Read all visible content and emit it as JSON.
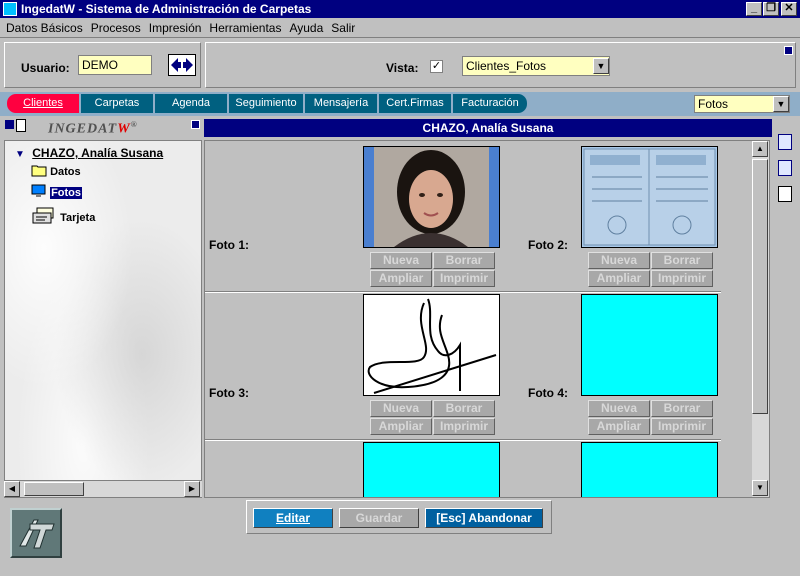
{
  "window": {
    "title": "IngedatW - Sistema de Administración de Carpetas"
  },
  "menu": [
    "Datos Básicos",
    "Procesos",
    "Impresión",
    "Herramientas",
    "Ayuda",
    "Salir"
  ],
  "user": {
    "label": "Usuario:",
    "value": "DEMO"
  },
  "view": {
    "label": "Vista:",
    "checked": "✓",
    "selected": "Clientes_Fotos"
  },
  "tabs": [
    "Clientes",
    "Carpetas",
    "Agenda",
    "Seguimiento",
    "Mensajería",
    "Cert.Firmas",
    "Facturación"
  ],
  "tab_select": "Fotos",
  "brand": {
    "main": "INGEDAT",
    "accent": "W",
    "mark": "®"
  },
  "tree": {
    "client": "CHAZO, Analía Susana",
    "items": [
      "Datos",
      "Fotos",
      "Tarjeta"
    ]
  },
  "client_header": "CHAZO, Analía Susana",
  "photos": [
    {
      "label": "Foto 1:"
    },
    {
      "label": "Foto 2:"
    },
    {
      "label": "Foto 3:"
    },
    {
      "label": "Foto 4:"
    }
  ],
  "photo_buttons": {
    "new": "Nueva",
    "delete": "Borrar",
    "enlarge": "Ampliar",
    "print": "Imprimir"
  },
  "bottom_buttons": {
    "edit": "Editar",
    "save": "Guardar",
    "cancel": "[Esc] Abandonar"
  },
  "colors": {
    "title_bar": "#000080",
    "tab": "#006080",
    "tab_active": "#ff0040",
    "input_bg": "#ffffc0",
    "empty_photo": "#00ffff",
    "edit_button": "#1080c0",
    "cancel_button": "#0060a0"
  }
}
